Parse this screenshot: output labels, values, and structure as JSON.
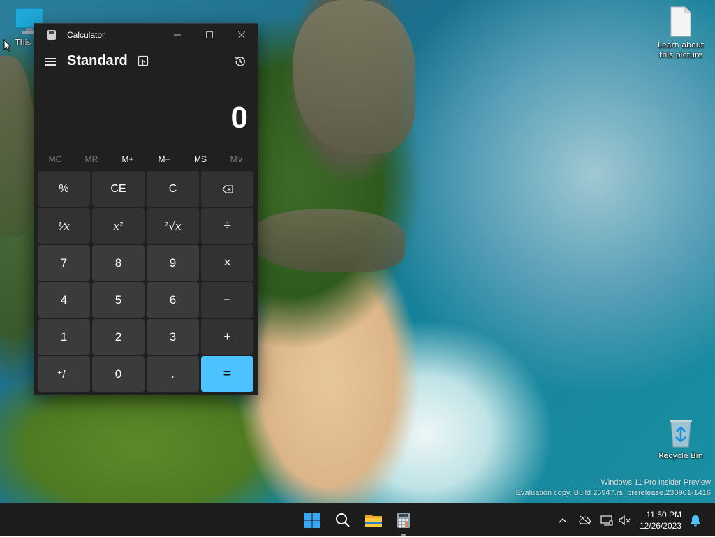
{
  "desktop": {
    "icons": [
      {
        "label": "This PC"
      },
      {
        "label": "Learn about this picture"
      },
      {
        "label": "Recycle Bin"
      }
    ],
    "watermark": {
      "line1": "Windows 11 Pro Insider Preview",
      "line2": "Evaluation copy. Build 25947.rs_prerelease.230901-1416"
    }
  },
  "calculator": {
    "window_title": "Calculator",
    "mode": "Standard",
    "display_value": "0",
    "memory_buttons": [
      {
        "label": "MC",
        "enabled": false
      },
      {
        "label": "MR",
        "enabled": false
      },
      {
        "label": "M+",
        "enabled": true
      },
      {
        "label": "M−",
        "enabled": true
      },
      {
        "label": "MS",
        "enabled": true
      },
      {
        "label": "M∨",
        "enabled": false
      }
    ],
    "keys": {
      "percent": "%",
      "clear_entry": "CE",
      "clear": "C",
      "backspace": "⌫",
      "reciprocal": "⅟x",
      "square": "x²",
      "sqrt": "²√x",
      "divide": "÷",
      "seven": "7",
      "eight": "8",
      "nine": "9",
      "multiply": "×",
      "four": "4",
      "five": "5",
      "six": "6",
      "subtract": "−",
      "one": "1",
      "two": "2",
      "three": "3",
      "add": "+",
      "negate": "⁺/₋",
      "zero": "0",
      "decimal": ".",
      "equals": "="
    },
    "accent_color": "#4cc2ff"
  },
  "taskbar": {
    "apps": [
      "start-icon",
      "search-icon",
      "file-explorer-icon",
      "calculator-icon"
    ],
    "tray": [
      "chevron-up-icon",
      "network-off-icon",
      "monitor-icon",
      "speaker-muted-icon"
    ],
    "time": "11:50 PM",
    "date": "12/26/2023"
  }
}
